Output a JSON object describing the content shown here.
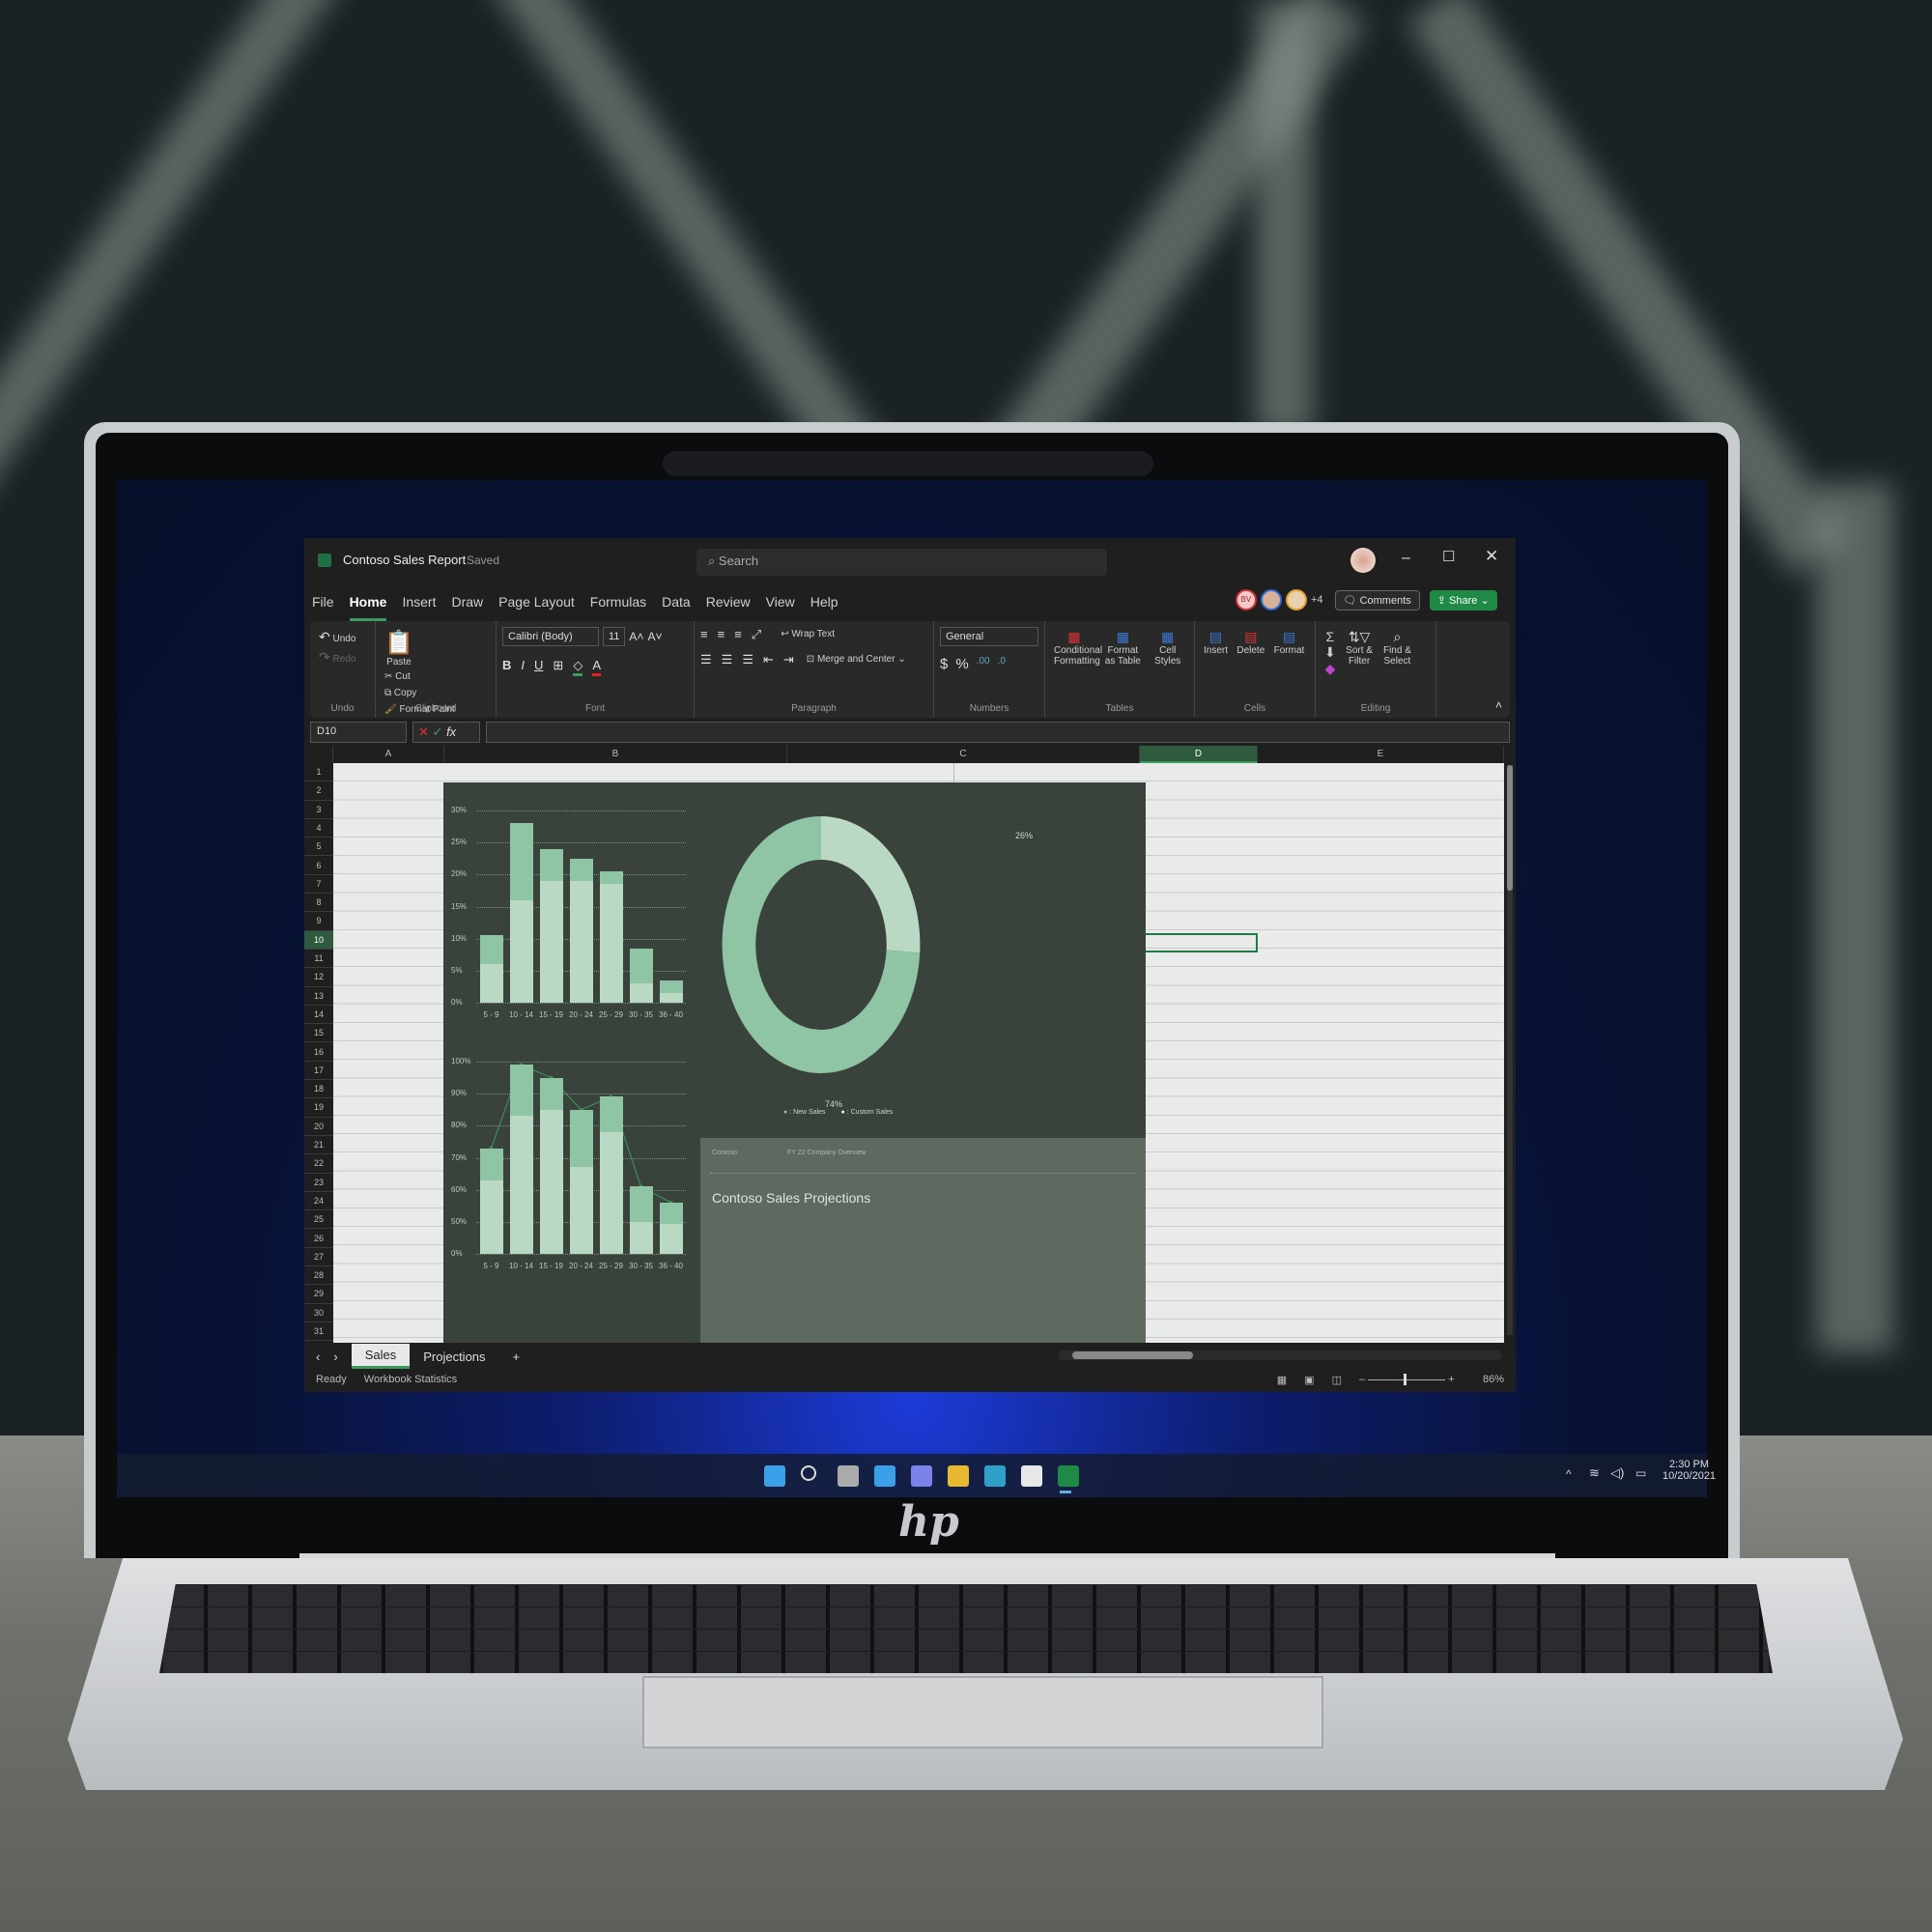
{
  "window": {
    "app_icon": "excel-icon",
    "title": "Contoso Sales Report",
    "save_state": "Saved",
    "search_placeholder": "Search"
  },
  "tabs": [
    "File",
    "Home",
    "Insert",
    "Draw",
    "Page Layout",
    "Formulas",
    "Data",
    "Review",
    "View",
    "Help"
  ],
  "active_tab": "Home",
  "collab": {
    "avatars": [
      "BV",
      "avatar-2",
      "avatar-3"
    ],
    "more": "+4",
    "comments": "Comments",
    "share": "Share"
  },
  "ribbon": {
    "undo": {
      "undo": "Undo",
      "redo": "Redo",
      "label": "Undo"
    },
    "clipboard": {
      "paste": "Paste",
      "cut": "Cut",
      "copy": "Copy",
      "format_paint": "Format Paint",
      "label": "Clipboard"
    },
    "font": {
      "name": "Calibri (Body)",
      "size": "11",
      "bold": "B",
      "italic": "I",
      "underline": "U",
      "label": "Font"
    },
    "paragraph": {
      "wrap": "Wrap Text",
      "merge": "Merge and Center",
      "label": "Paragraph"
    },
    "numbers": {
      "format": "General",
      "currency": "$",
      "percent": "%",
      "label": "Numbers"
    },
    "tables": {
      "cond": "Conditional Formatting",
      "fmt_table": "Format as Table",
      "styles": "Cell Styles",
      "label": "Tables"
    },
    "cells": {
      "insert": "Insert",
      "delete": "Delete",
      "format": "Format",
      "label": "Cells"
    },
    "editing": {
      "sum": "Σ",
      "sort": "Sort & Filter",
      "find": "Find & Select",
      "label": "Editing"
    }
  },
  "formula_bar": {
    "name_box": "D10",
    "fx": "fx",
    "value": ""
  },
  "columns": [
    "A",
    "B",
    "C",
    "D",
    "E"
  ],
  "selected_cell": "D10",
  "rows": 31,
  "sheets": [
    {
      "label": "Sales",
      "active": true
    },
    {
      "label": "Projections",
      "active": false
    }
  ],
  "status": {
    "ready": "Ready",
    "stats": "Workbook Statistics",
    "zoom": "86%",
    "zoom_level": 86
  },
  "embedded": {
    "bar_top": {
      "categories": [
        "5 - 9",
        "10 - 14",
        "15 - 19",
        "20 - 24",
        "25 - 29",
        "30 - 35",
        "36 - 40"
      ],
      "yticks": [
        "0%",
        "5%",
        "10%",
        "15%",
        "20%",
        "25%",
        "30%"
      ],
      "lower": [
        6,
        16,
        19,
        19,
        18.5,
        3,
        1.5
      ],
      "total": [
        10.5,
        28,
        24,
        22.5,
        20.5,
        8.5,
        3.5
      ],
      "ymax": 30
    },
    "bar_bottom": {
      "categories": [
        "5 - 9",
        "10 - 14",
        "15 - 19",
        "20 - 24",
        "25 - 29",
        "30 - 35",
        "36 - 40"
      ],
      "yticks": [
        "0%",
        "50%",
        "60%",
        "70%",
        "80%",
        "90%",
        "100%"
      ],
      "lower": [
        63,
        83,
        85,
        67,
        78,
        50,
        47
      ],
      "total": [
        73,
        99,
        95,
        85,
        89,
        61,
        56
      ]
    },
    "donut": {
      "slices": [
        {
          "name": "New Sales",
          "value": 74,
          "label": "74%",
          "color": "#8fc4a4"
        },
        {
          "name": "Custom Sales",
          "value": 26,
          "label": "26%",
          "color": "#b9d9c4"
        }
      ],
      "legend": [
        ": New Sales",
        ": Custom Sales"
      ]
    },
    "info": {
      "company": "Contoso",
      "subtitle": "FY 22 Company Overview",
      "title": "Contoso Sales Projections"
    },
    "colors": {
      "bar_lower": "#b9d9c4",
      "bar_upper": "#8fc4a4",
      "panel": "#39433b"
    }
  },
  "taskbar": {
    "icons": [
      "windows-start-icon",
      "search-icon",
      "task-view-icon",
      "widgets-icon",
      "teams-icon",
      "file-explorer-icon",
      "edge-icon",
      "store-icon",
      "excel-icon"
    ],
    "time": "2:30 PM",
    "date": "10/20/2021"
  },
  "brand": "hp"
}
